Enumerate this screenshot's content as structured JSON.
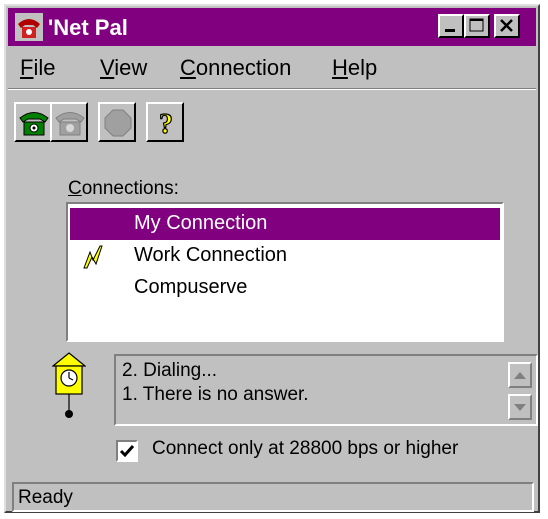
{
  "window": {
    "title": "'Net Pal"
  },
  "menu": [
    {
      "label": "File",
      "mnemonic": "F",
      "rest": "ile"
    },
    {
      "label": "View",
      "mnemonic": "V",
      "rest": "iew"
    },
    {
      "label": "Connection",
      "mnemonic": "C",
      "rest": "onnection"
    },
    {
      "label": "Help",
      "mnemonic": "H",
      "rest": "elp"
    }
  ],
  "toolbar": {
    "buttons": [
      {
        "icon": "phone-dial-icon",
        "enabled": true
      },
      {
        "icon": "phone-hangup-icon",
        "enabled": false
      },
      {
        "icon": "stop-icon",
        "enabled": false
      },
      {
        "icon": "help-question-icon",
        "enabled": true
      }
    ]
  },
  "connections": {
    "label_mnemonic": "C",
    "label_rest": "onnections:",
    "items": [
      {
        "label": "My Connection",
        "selected": true,
        "icon": null
      },
      {
        "label": "Work Connection",
        "selected": false,
        "icon": "lightning-icon"
      },
      {
        "label": "Compuserve",
        "selected": false,
        "icon": null
      }
    ]
  },
  "status_log": {
    "icon": "cuckoo-clock-icon",
    "lines": [
      "2. Dialing...",
      "1. There is no answer."
    ]
  },
  "options": {
    "connect_only_label": "Connect only at 28800 bps or higher",
    "connect_only_checked": true
  },
  "statusbar": {
    "text": "Ready"
  },
  "colors": {
    "titlebar": "#800080",
    "selection": "#800080",
    "face": "#c0c0c0"
  }
}
